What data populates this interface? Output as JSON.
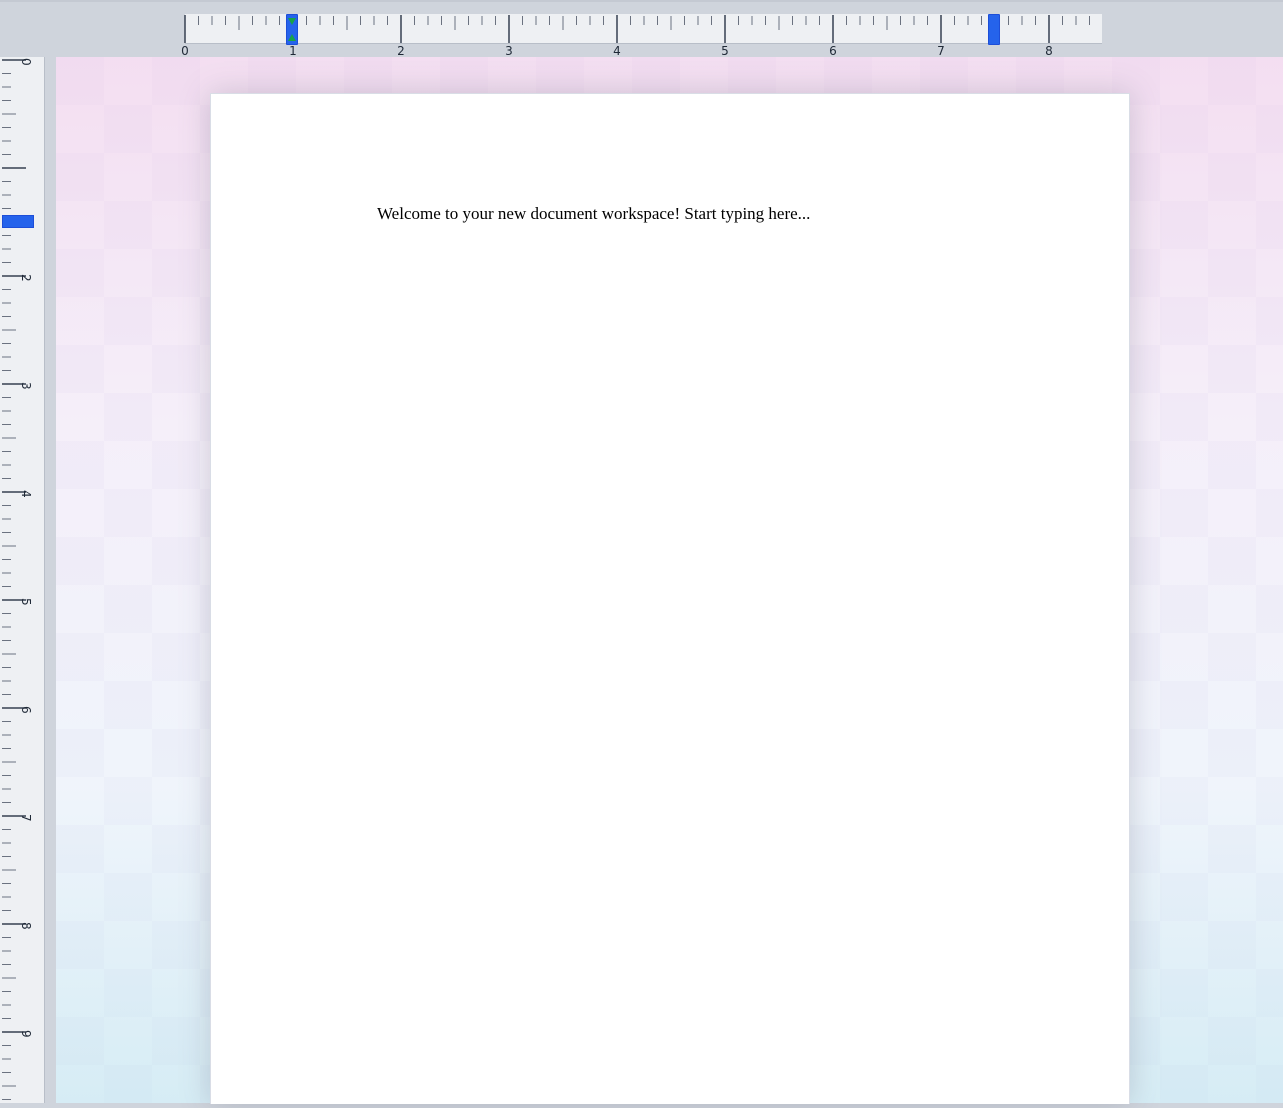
{
  "rulers": {
    "horizontal_labels": [
      "0",
      "1",
      "2",
      "3",
      "4",
      "5",
      "6",
      "7",
      "8"
    ],
    "vertical_labels": [
      "0",
      "2",
      "3",
      "4",
      "5",
      "6",
      "7",
      "8",
      "9"
    ],
    "unit": "inches"
  },
  "document": {
    "body_text": "Welcome to your new document workspace! Start typing here..."
  },
  "colors": {
    "marker": "#2563eb",
    "indent_marker": "#16a34a",
    "ruler_background": "#eef0f3",
    "chrome_background": "#cfd4dc"
  }
}
